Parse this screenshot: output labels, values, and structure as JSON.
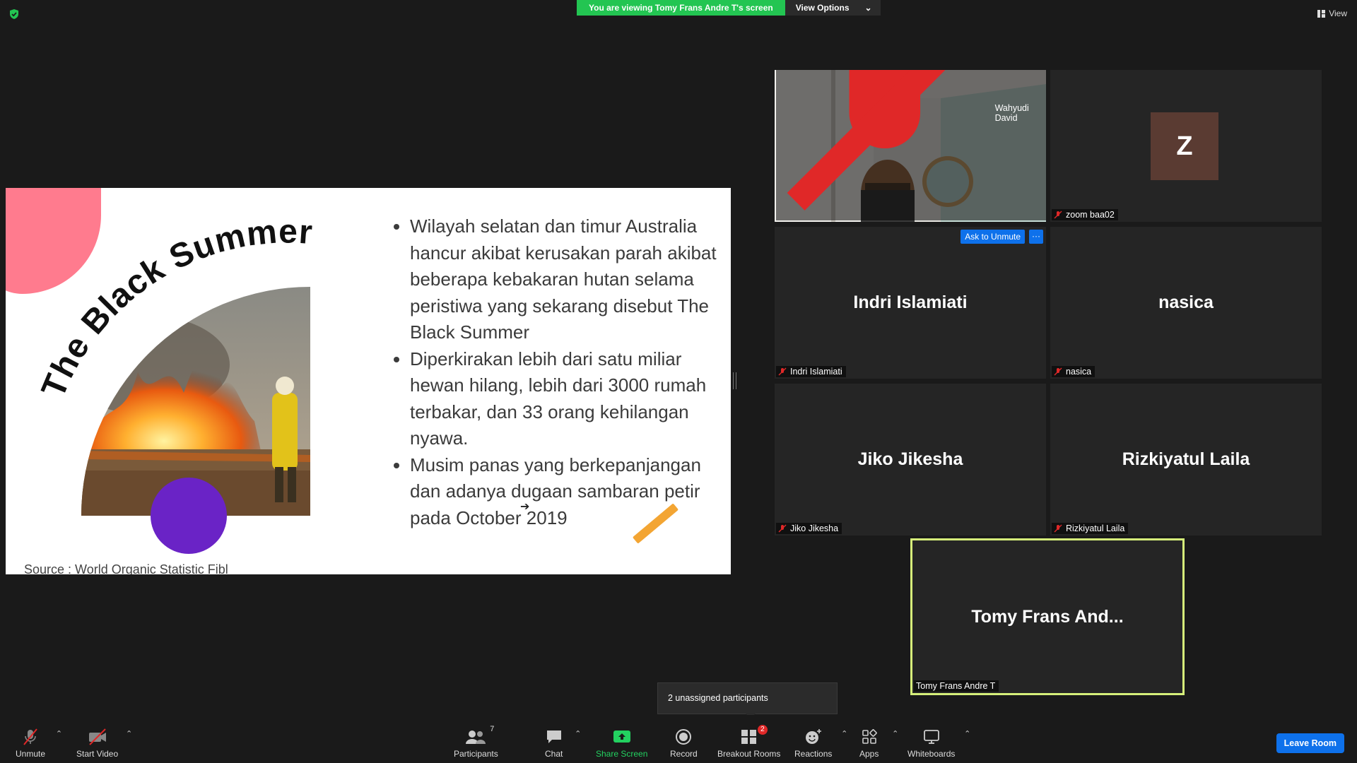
{
  "banner": {
    "viewing_text": "You are viewing Tomy Frans Andre T's screen",
    "view_options_label": "View Options",
    "view_label": "View"
  },
  "slide": {
    "title": "The Black Summer",
    "bullets": [
      "Wilayah selatan dan timur Australia hancur akibat kerusakan parah akibat beberapa kebakaran hutan selama peristiwa yang sekarang disebut The Black Summer",
      "Diperkirakan lebih dari satu miliar hewan hilang, lebih dari 3000 rumah terbakar, dan 33 orang kehilangan nyawa.",
      "Musim panas yang berkepanjangan dan adanya dugaan sambaran petir pada October 2019"
    ],
    "source": "Source : World Organic Statistic Fibl"
  },
  "participants_tiles": [
    {
      "name": "Wahyudi David",
      "type": "video"
    },
    {
      "name": "zoom baa02",
      "type": "avatar",
      "initial": "Z"
    },
    {
      "name": "Indri Islamiati",
      "type": "name"
    },
    {
      "name": "nasica",
      "type": "name"
    },
    {
      "name": "Jiko Jikesha",
      "type": "name"
    },
    {
      "name": "Rizkiyatul Laila",
      "type": "name"
    },
    {
      "name": "Tomy Frans Andre T",
      "display": "Tomy Frans And...",
      "type": "name"
    }
  ],
  "tile_actions": {
    "ask_unmute": "Ask to Unmute",
    "more": "···"
  },
  "tooltip": "2 unassigned participants",
  "toolbar": {
    "unmute": "Unmute",
    "start_video": "Start Video",
    "participants": "Participants",
    "participants_count": "7",
    "chat": "Chat",
    "share_screen": "Share Screen",
    "record": "Record",
    "breakout_rooms": "Breakout Rooms",
    "breakout_badge": "2",
    "reactions": "Reactions",
    "apps": "Apps",
    "whiteboards": "Whiteboards",
    "leave_room": "Leave Room"
  },
  "colors": {
    "banner_green": "#23c552",
    "accent_blue": "#0e71eb",
    "active_speaker": "#d6f07a",
    "muted_red": "#e02828"
  }
}
